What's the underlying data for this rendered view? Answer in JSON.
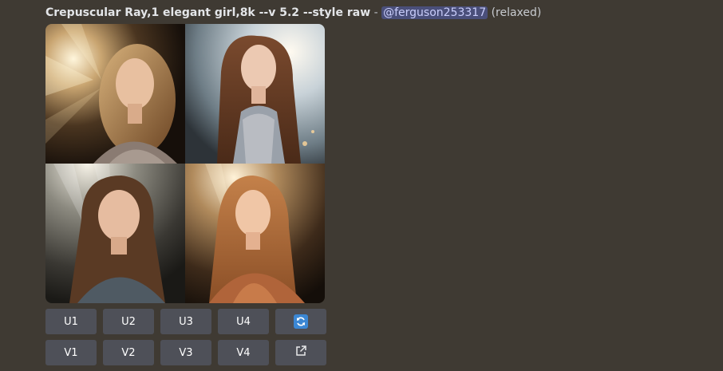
{
  "message": {
    "prompt": "Crepuscular Ray,1 elegant girl,8k --v 5.2 --style raw",
    "separator": "-",
    "mention": "@ferguson253317",
    "mode": "(relaxed)"
  },
  "images": [
    {
      "icon": "portrait-image"
    },
    {
      "icon": "portrait-image"
    },
    {
      "icon": "portrait-image"
    },
    {
      "icon": "portrait-image"
    }
  ],
  "buttons": {
    "upscale": [
      "U1",
      "U2",
      "U3",
      "U4"
    ],
    "variation": [
      "V1",
      "V2",
      "V3",
      "V4"
    ],
    "reroll_icon": "refresh-icon",
    "open_icon": "external-link-icon"
  },
  "colors": {
    "background": "#3f3a33",
    "button": "#4e5058",
    "mention_bg": "#4a4f7a",
    "reroll_accent": "#3b87d4"
  }
}
